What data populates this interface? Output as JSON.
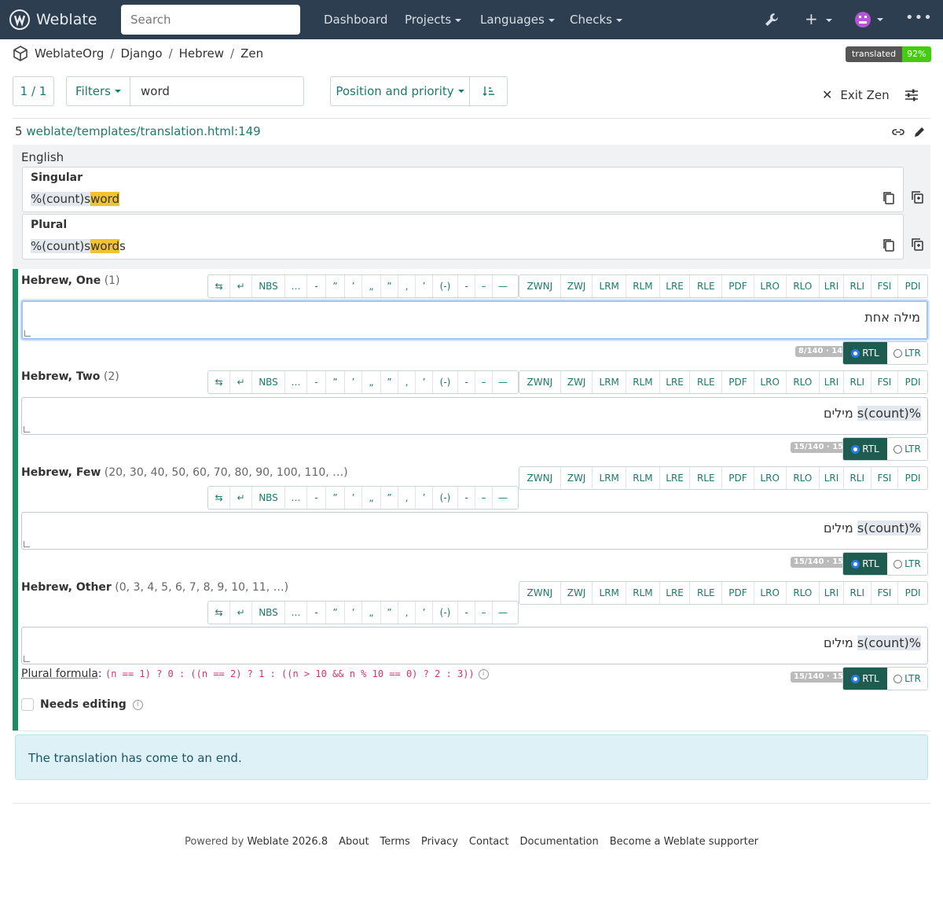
{
  "nav": {
    "brand": "Weblate",
    "search_placeholder": "Search",
    "items": [
      "Dashboard",
      "Projects",
      "Languages",
      "Checks"
    ]
  },
  "breadcrumb": [
    "WeblateOrg",
    "Django",
    "Hebrew",
    "Zen"
  ],
  "status_badge": {
    "label": "translated",
    "value": "92%"
  },
  "toolbar": {
    "position": "1 / 1",
    "filters_label": "Filters",
    "query": "word",
    "sort_label": "Position and priority",
    "exit_zen": "Exit Zen"
  },
  "unit": {
    "number": "5",
    "location": "weblate/templates/translation.html:149",
    "source_language": "English",
    "singular_title": "Singular",
    "singular_prefix": "%(count)s",
    "singular_hl": "word",
    "singular_suffix": "",
    "plural_title": "Plural",
    "plural_prefix": "%(count)s",
    "plural_hl": "word",
    "plural_suffix": "s"
  },
  "char_buttons": [
    "⇆",
    "↵",
    "NBS",
    "…",
    "-",
    "”",
    "’",
    "„",
    "”",
    ",",
    "’",
    "(-)",
    "-",
    "–",
    "—"
  ],
  "dir_buttons": [
    "ZWNJ",
    "ZWJ",
    "LRM",
    "RLM",
    "LRE",
    "RLE",
    "PDF",
    "LRO",
    "RLO",
    "LRI",
    "RLI",
    "FSI",
    "PDI"
  ],
  "forms": [
    {
      "name": "Hebrew, One",
      "nums": "(1)",
      "text": "מילה אחת",
      "count": "8/140 · 14"
    },
    {
      "name": "Hebrew, Two",
      "nums": "(2)",
      "text_hl": "%(count)s",
      "text": "מילים",
      "count": "15/140 · 15"
    },
    {
      "name": "Hebrew, Few",
      "nums": "(20, 30, 40, 50, 60, 70, 80, 90, 100, 110, …)",
      "text_hl": "%(count)s",
      "text": "מילים",
      "count": "15/140 · 15"
    },
    {
      "name": "Hebrew, Other",
      "nums": "(0, 3, 4, 5, 6, 7, 8, 9, 10, 11, …)",
      "text_hl": "%(count)s",
      "text": "מילים",
      "count": "15/140 · 15"
    }
  ],
  "direction": {
    "rtl": "RTL",
    "ltr": "LTR"
  },
  "plural_formula_label": "Plural formula",
  "plural_formula": "(n == 1) ? 0 : ((n == 2) ? 1 : ((n > 10 && n % 10 == 0) ? 2 : 3))",
  "needs_editing": "Needs editing",
  "end_message": "The translation has come to an end.",
  "footer": {
    "powered": "Powered by",
    "version": "Weblate 2026.8",
    "links": [
      "About",
      "Terms",
      "Privacy",
      "Contact",
      "Documentation",
      "Become a Weblate supporter"
    ]
  }
}
